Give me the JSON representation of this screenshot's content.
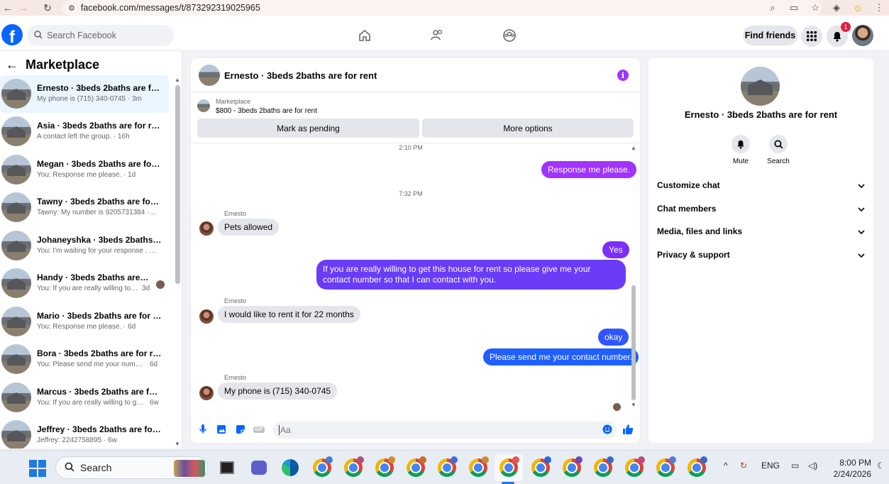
{
  "browser": {
    "url": "facebook.com/messages/t/873292319025965"
  },
  "header": {
    "search_placeholder": "Search Facebook",
    "find_friends": "Find friends",
    "notification_count": "1"
  },
  "sidebar": {
    "title": "Marketplace",
    "conversations": [
      {
        "name": "Ernesto · 3beds 2baths are for r...",
        "preview": "My phone is (715) 340-0745 · 3m",
        "time": ""
      },
      {
        "name": "Asia · 3beds 2baths are for rent",
        "preview": "A contact left the group. · 16h",
        "time": ""
      },
      {
        "name": "Megan · 3beds 2baths are for rent",
        "preview": "You: Response me please. · 1d",
        "time": ""
      },
      {
        "name": "Tawny · 3beds 2baths are for rent",
        "preview": "Tawny: My number is 9205731384 · 3d",
        "time": ""
      },
      {
        "name": "Johaneyshka · 3beds 2baths are ...",
        "preview": "You: I'm waiting for your response . · 3d",
        "time": ""
      },
      {
        "name": "Handy · 3beds 2baths are for ...",
        "preview": "You: If you are really willing to g...",
        "time": "3d"
      },
      {
        "name": "Mario · 3beds 2baths are for rent",
        "preview": "You: Response me please. · 6d",
        "time": ""
      },
      {
        "name": "Bora · 3beds 2baths are for rent",
        "preview": "You: Please send me your number ...",
        "time": "6d"
      },
      {
        "name": "Marcus · 3beds 2baths are for re...",
        "preview": "You: If you are really willing to get ...",
        "time": "6w"
      },
      {
        "name": "Jeffrey · 3beds 2baths are for rent",
        "preview": "Jeffrey: 2242758895 · 6w",
        "time": ""
      }
    ]
  },
  "chat": {
    "title": "Ernesto · 3beds 2baths are for rent",
    "listing_source": "Marketplace",
    "listing_price": "$800 - 3beds 2baths are for rent",
    "mark_pending": "Mark as pending",
    "more_options": "More options",
    "ts1": "2:10 PM",
    "ts2": "7:32 PM",
    "sender_name": "Ernesto",
    "messages": {
      "m1": "Response me please.",
      "m2": "Pets allowed",
      "m3": "Yes",
      "m4": "If you are really willing to get this house for rent so please give me your contact number so that I  can contact with you.",
      "m5": "I would like to rent it for 22 months",
      "m6": "okay",
      "m7": "Please send me your contact number.",
      "m8": "My phone is (715) 340-0745"
    },
    "composer_placeholder": "Aa",
    "gif_label": "GIF"
  },
  "info": {
    "title": "Ernesto · 3beds 2baths are for rent",
    "mute": "Mute",
    "search": "Search",
    "sections": [
      "Customize chat",
      "Chat members",
      "Media, files and links",
      "Privacy & support"
    ]
  },
  "taskbar": {
    "search": "Search",
    "lang": "ENG",
    "time": "8:00 PM",
    "date": "2/24/2026"
  },
  "colors": {
    "fb_blue": "#0866ff",
    "bubble_purple": "#a033ff",
    "bubble_violet": "#7b2ff7",
    "bubble_blue": "#1f5fff"
  }
}
